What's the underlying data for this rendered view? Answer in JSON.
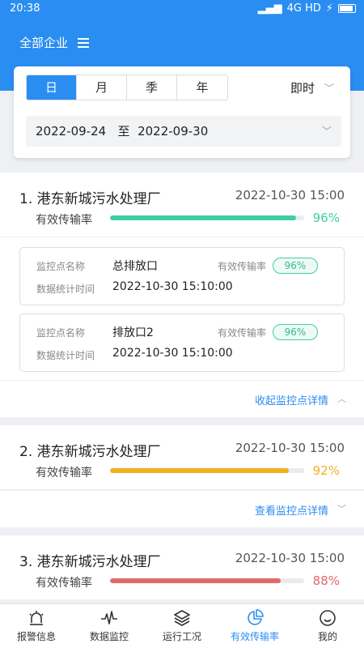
{
  "status_bar": {
    "time": "20:38",
    "network": "4G HD"
  },
  "header": {
    "company_filter": "全部企业"
  },
  "filters": {
    "period_tabs": [
      "日",
      "月",
      "季",
      "年"
    ],
    "active_period": 0,
    "mode": "即时",
    "date_start": "2022-09-24",
    "date_sep": "至",
    "date_end": "2022-09-30"
  },
  "colors": {
    "primary": "#2a8df2",
    "green": "#3dcfa5",
    "orange": "#f2b01e",
    "red": "#e26a66"
  },
  "plants": [
    {
      "title": "1. 港东新城污水处理厂",
      "time": "2022-10-30 15:00",
      "rate_label": "有效传输率",
      "rate": 96,
      "rate_text": "96%",
      "color": "#3dcfa5",
      "points": [
        {
          "name_label": "监控点名称",
          "name": "总排放口",
          "rate_label": "有效传输率",
          "rate_text": "96%",
          "time_label": "数据统计时间",
          "time": "2022-10-30 15:10:00"
        },
        {
          "name_label": "监控点名称",
          "name": "排放口2",
          "rate_label": "有效传输率",
          "rate_text": "96%",
          "time_label": "数据统计时间",
          "time": "2022-10-30 15:10:00"
        }
      ],
      "detail_text": "收起监控点详情"
    },
    {
      "title": "2. 港东新城污水处理厂",
      "time": "2022-10-30 15:00",
      "rate_label": "有效传输率",
      "rate": 92,
      "rate_text": "92%",
      "color": "#f2b01e",
      "points": [],
      "detail_text": "查看监控点详情"
    },
    {
      "title": "3. 港东新城污水处理厂",
      "time": "2022-10-30 15:00",
      "rate_label": "有效传输率",
      "rate": 88,
      "rate_text": "88%",
      "color": "#e26a66",
      "points": [],
      "detail_text": ""
    }
  ],
  "tabbar": [
    {
      "label": "报警信息",
      "icon": "alarm-icon"
    },
    {
      "label": "数据监控",
      "icon": "pulse-icon"
    },
    {
      "label": "运行工况",
      "icon": "layers-icon"
    },
    {
      "label": "有效传输率",
      "icon": "pie-chart-icon"
    },
    {
      "label": "我的",
      "icon": "smile-icon"
    }
  ],
  "active_tab": 3
}
